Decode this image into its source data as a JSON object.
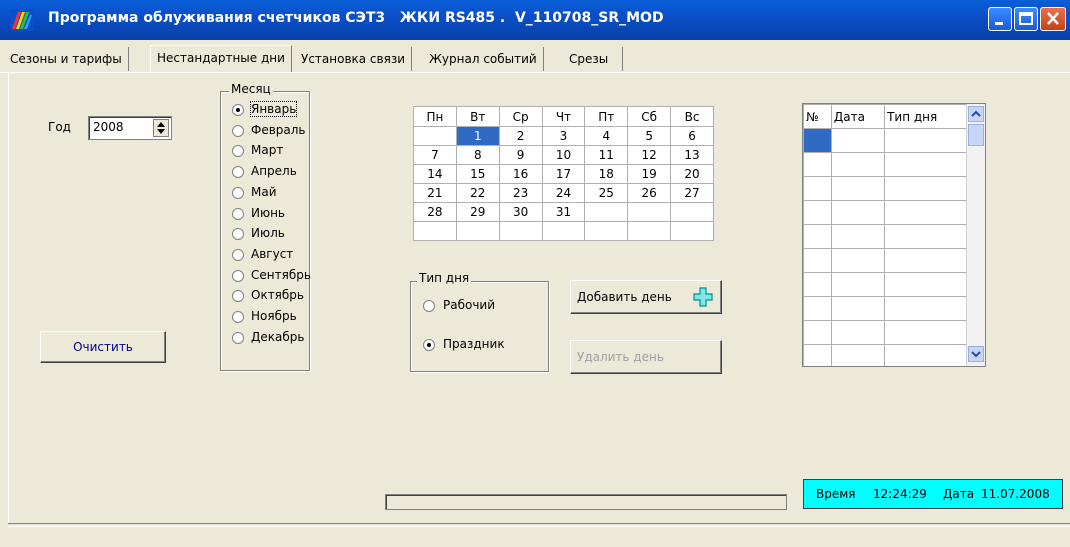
{
  "window": {
    "title": "Программа облуживания счетчиков СЭТ3   ЖКИ RS485 .  V_110708_SR_MOD"
  },
  "tabs": [
    {
      "label": "Сезоны и тарифы"
    },
    {
      "label": "Нестандартные дни",
      "active": true
    },
    {
      "label": "Установка связи"
    },
    {
      "label": "Журнал событий"
    },
    {
      "label": "Срезы"
    }
  ],
  "year": {
    "label": "Год",
    "value": "2008"
  },
  "month_group": {
    "legend": "Месяц",
    "selected": "Январь",
    "options": [
      "Январь",
      "Февраль",
      "Март",
      "Апрель",
      "Май",
      "Июнь",
      "Июль",
      "Август",
      "Сентябрь",
      "Октябрь",
      "Ноябрь",
      "Декабрь"
    ]
  },
  "clear_button": {
    "label": "Очистить"
  },
  "calendar": {
    "weekdays": [
      "Пн",
      "Вт",
      "Ср",
      "Чт",
      "Пт",
      "Сб",
      "Вс"
    ],
    "weeks": [
      [
        "",
        "1",
        "2",
        "3",
        "4",
        "5",
        "6"
      ],
      [
        "7",
        "8",
        "9",
        "10",
        "11",
        "12",
        "13"
      ],
      [
        "14",
        "15",
        "16",
        "17",
        "18",
        "19",
        "20"
      ],
      [
        "21",
        "22",
        "23",
        "24",
        "25",
        "26",
        "27"
      ],
      [
        "28",
        "29",
        "30",
        "31",
        "",
        "",
        ""
      ],
      [
        "",
        "",
        "",
        "",
        "",
        "",
        ""
      ]
    ],
    "selected_day": "1"
  },
  "day_type": {
    "legend": "Тип дня",
    "options": [
      {
        "label": "Рабочий",
        "checked": false
      },
      {
        "label": "Праздник",
        "checked": true
      }
    ]
  },
  "add_day_button": {
    "label": "Добавить день"
  },
  "delete_day_button": {
    "label": "Удалить день"
  },
  "day_list": {
    "columns": [
      "№",
      "Дата",
      "Тип дня"
    ]
  },
  "status": {
    "time_label": "Время",
    "time_value": "12:24:29",
    "date_label": "Дата",
    "date_value": "11.07.2008",
    "text": "Время    12:24:29  Дата  11.07.2008"
  },
  "colors": {
    "title_bar": "#0a4fc9",
    "selection": "#316ac5",
    "status_bg": "#00ffff",
    "add_icon": "#00c0c0"
  },
  "icons": {
    "app": "rainbow-logo-icon",
    "minimize": "minimize-icon",
    "maximize": "maximize-icon",
    "close": "close-icon",
    "add": "plus-icon"
  }
}
